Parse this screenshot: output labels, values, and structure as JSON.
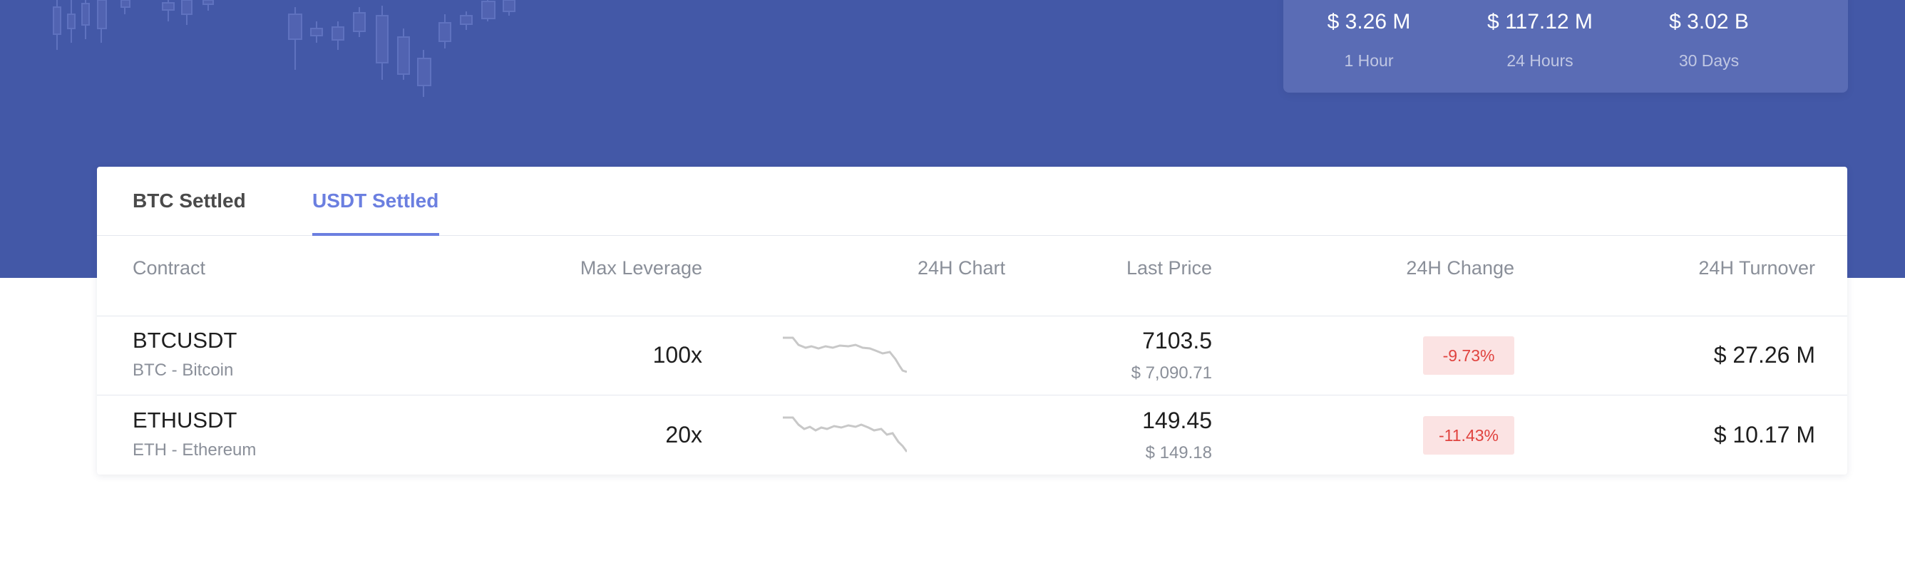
{
  "stats": [
    {
      "value": "$ 3.26 M",
      "label": "1 Hour"
    },
    {
      "value": "$ 117.12 M",
      "label": "24 Hours"
    },
    {
      "value": "$ 3.02 B",
      "label": "30 Days"
    }
  ],
  "tabs": [
    {
      "label": "BTC Settled",
      "active": false
    },
    {
      "label": "USDT Settled",
      "active": true
    }
  ],
  "table": {
    "headers": {
      "contract": "Contract",
      "max_leverage": "Max Leverage",
      "chart": "24H Chart",
      "last_price": "Last Price",
      "change": "24H Change",
      "turnover": "24H Turnover"
    },
    "rows": [
      {
        "symbol": "BTCUSDT",
        "name": "BTC - Bitcoin",
        "leverage": "100x",
        "last_price": "7103.5",
        "last_price_usd": "$ 7,090.71",
        "change": "-9.73%",
        "turnover": "$ 27.26 M"
      },
      {
        "symbol": "ETHUSDT",
        "name": "ETH - Ethereum",
        "leverage": "20x",
        "last_price": "149.45",
        "last_price_usd": "$ 149.18",
        "change": "-11.43%",
        "turnover": "$ 10.17 M"
      }
    ]
  },
  "colors": {
    "hero_bg": "#4358a7",
    "accent": "#6b7fe0",
    "negative": "#e0433f",
    "negative_bg": "#fbe3e3"
  },
  "icons": [
    "candlestick-background-decoration",
    "sparkline-chart"
  ]
}
